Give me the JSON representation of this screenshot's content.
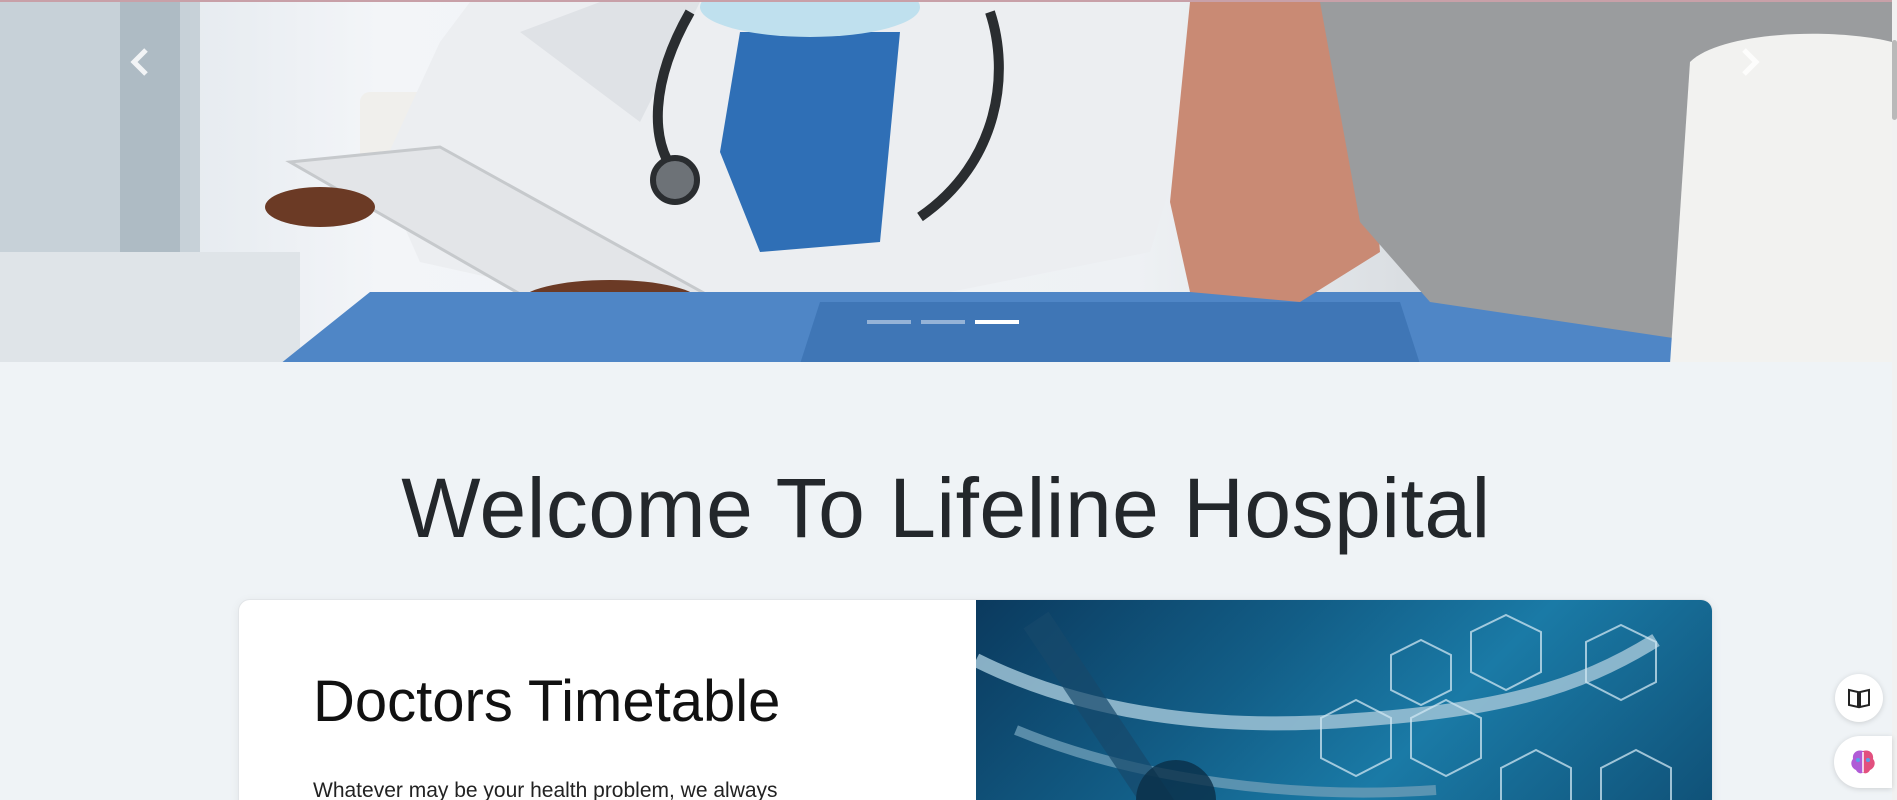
{
  "hero": {
    "prev_icon": "chevron-left-icon",
    "next_icon": "chevron-right-icon",
    "slides": 3,
    "active_slide": 3
  },
  "welcome": {
    "title": "Welcome To Lifeline Hospital"
  },
  "timetable_card": {
    "title": "Doctors Timetable",
    "description": "Whatever may be your health problem, we always"
  },
  "floating_buttons": {
    "reader_icon": "book-icon",
    "ai_icon": "brain-icon"
  },
  "colors": {
    "page_bg": "#eff3f6",
    "scrub_blue": "#2f6fb6",
    "title_text": "#23272b"
  }
}
